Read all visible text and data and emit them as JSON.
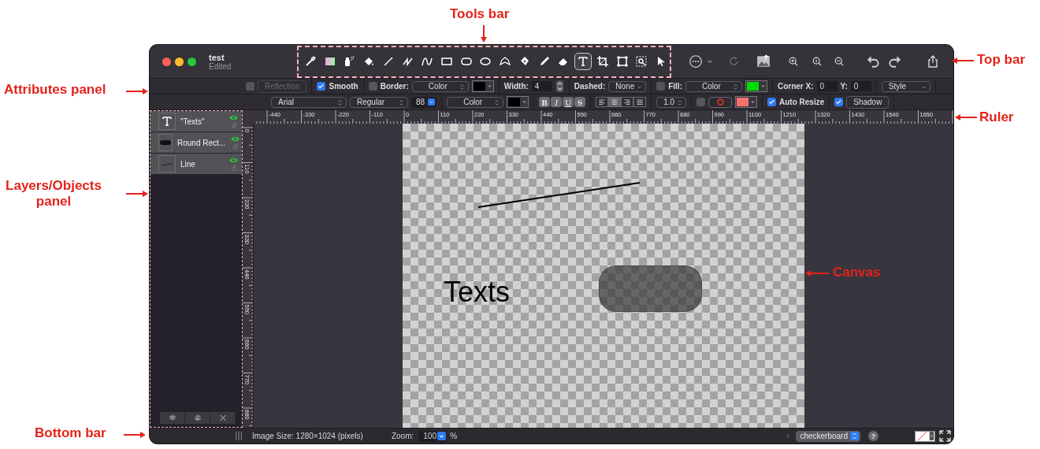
{
  "annotations": [
    {
      "label": "Tools bar"
    },
    {
      "label": "Top bar"
    },
    {
      "label": "Attributes panel"
    },
    {
      "label": "Ruler"
    },
    {
      "label": "Layers/Objects panel"
    },
    {
      "label": "Canvas"
    },
    {
      "label": "Bottom bar"
    }
  ],
  "window": {
    "title": "test",
    "subtitle": "Edited"
  },
  "tools": [
    {
      "kind": "eyedropper",
      "selected": false
    },
    {
      "kind": "gradient",
      "selected": false
    },
    {
      "kind": "spray",
      "selected": false
    },
    {
      "kind": "bucket",
      "selected": false
    },
    {
      "kind": "line",
      "selected": false
    },
    {
      "kind": "zigzag",
      "selected": false
    },
    {
      "kind": "curve",
      "selected": false
    },
    {
      "kind": "rect",
      "selected": false
    },
    {
      "kind": "roundrect",
      "selected": false
    },
    {
      "kind": "ellipse",
      "selected": false
    },
    {
      "kind": "polygon",
      "selected": false
    },
    {
      "kind": "pen",
      "selected": false
    },
    {
      "kind": "pencil",
      "selected": false
    },
    {
      "kind": "eraser",
      "selected": false
    },
    {
      "kind": "text",
      "selected": true
    },
    {
      "kind": "crop",
      "selected": false
    },
    {
      "kind": "transform",
      "selected": false
    },
    {
      "kind": "zoomselect",
      "selected": false
    },
    {
      "kind": "pointer",
      "selected": false
    }
  ],
  "attributes": {
    "row_1": [
      [
        {
          "kind": "checkbox",
          "checked": false
        },
        {
          "kind": "button",
          "label": "Reflection",
          "disabled": true
        }
      ],
      [
        {
          "kind": "checkbox",
          "checked": true,
          "label": "Smooth"
        }
      ],
      [
        {
          "kind": "checkbox",
          "checked": false,
          "label": "Border:"
        },
        {
          "kind": "select",
          "value": "Color"
        },
        {
          "kind": "swatch",
          "color": "#000000"
        }
      ],
      [
        {
          "kind": "label",
          "text": "Width:"
        },
        {
          "kind": "number",
          "value": "4"
        },
        {
          "kind": "stepper"
        }
      ],
      [
        {
          "kind": "label",
          "text": "Dashed:"
        },
        {
          "kind": "dropdown",
          "value": "None"
        }
      ],
      [
        {
          "kind": "checkbox",
          "checked": false,
          "label": "Fill:"
        },
        {
          "kind": "select",
          "value": "Color"
        },
        {
          "kind": "swatch",
          "color": "#00dd00"
        }
      ],
      [
        {
          "kind": "label",
          "text": "Corner X:"
        },
        {
          "kind": "number",
          "value": "0"
        },
        {
          "kind": "label",
          "text": "Y:"
        },
        {
          "kind": "number",
          "value": "0"
        }
      ],
      [
        {
          "kind": "dropdown",
          "value": "Style"
        }
      ]
    ],
    "row_2": [
      [
        {
          "kind": "select",
          "value": "Arial"
        },
        {
          "kind": "select",
          "value": "Regular"
        },
        {
          "kind": "number-select",
          "value": "88"
        }
      ],
      [
        {
          "kind": "select",
          "value": "Color"
        },
        {
          "kind": "swatch",
          "color": "#000000"
        }
      ],
      [
        {
          "kind": "format",
          "label": "B",
          "selected": false
        },
        {
          "kind": "format",
          "label": "I",
          "selected": false
        },
        {
          "kind": "format",
          "label": "U",
          "selected": false
        },
        {
          "kind": "format",
          "label": "S",
          "selected": false
        }
      ],
      [
        {
          "kind": "align",
          "selected": false
        },
        {
          "kind": "align",
          "selected": true
        },
        {
          "kind": "align",
          "selected": false
        },
        {
          "kind": "align",
          "selected": false
        }
      ],
      [
        {
          "kind": "select",
          "value": "1.0"
        }
      ],
      [
        {
          "kind": "checkbox",
          "checked": false
        },
        {
          "kind": "ring-button"
        },
        {
          "kind": "swatch",
          "color": "#f87171"
        }
      ],
      [
        {
          "kind": "checkbox",
          "checked": true,
          "label": "Auto Resize"
        }
      ],
      [
        {
          "kind": "check-button",
          "checked": true,
          "label": "Shadow"
        }
      ]
    ]
  },
  "ruler": {
    "h_ticks": [
      "-440",
      "-330",
      "-220",
      "-110",
      "0",
      "110",
      "220",
      "330",
      "440",
      "550",
      "660",
      "770",
      "880",
      "990",
      "1100",
      "1210",
      "1320",
      "1430",
      "1540",
      "1650"
    ],
    "v_ticks": [
      "0",
      "110",
      "220",
      "330",
      "440",
      "550",
      "660",
      "770",
      "880"
    ]
  },
  "layers": [
    {
      "kind": "text",
      "name": "\"Texts\"",
      "visible": true
    },
    {
      "kind": "roundrect",
      "name": "Round Rect...",
      "visible": true
    },
    {
      "kind": "line",
      "name": "Line",
      "visible": true
    }
  ],
  "canvas": {
    "objects": [
      {
        "kind": "line"
      },
      {
        "kind": "text",
        "text": "Texts"
      },
      {
        "kind": "roundrect"
      }
    ]
  },
  "bottom_bar": {
    "image_size": "Image Size: 1280×1024 (pixels)",
    "zoom_label": "Zoom:",
    "zoom_value": "100",
    "zoom_unit": "%",
    "background": "checkerboard",
    "help": "?"
  }
}
